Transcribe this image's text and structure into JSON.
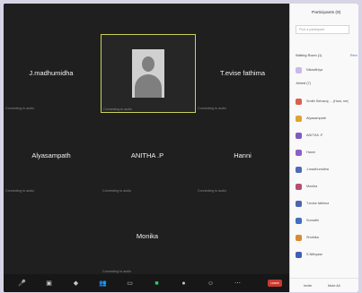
{
  "meeting": {
    "participants": [
      {
        "name": "J.madhumidha",
        "subtext": "Connecting to audio"
      },
      {
        "name": "",
        "subtext": "Connecting to audio"
      },
      {
        "name": "T.evise fathima",
        "subtext": "Connecting to audio"
      },
      {
        "name": "Alyasampath",
        "subtext": "Connecting to audio"
      },
      {
        "name": "ANITHA .P",
        "subtext": "Connecting to audio"
      },
      {
        "name": "Hanni",
        "subtext": "Connecting to audio"
      },
      {
        "name": "Monika",
        "subtext": "Connecting to audio"
      }
    ]
  },
  "toolbar": {
    "mic_icon": "microphone-icon",
    "video_icon": "video-icon",
    "security_icon": "shield-icon",
    "participants_icon": "people-icon",
    "chat_icon": "chat-icon",
    "share_icon": "share-screen-icon",
    "record_icon": "record-icon",
    "reactions_icon": "smile-icon",
    "apps_icon": "apps-icon",
    "more_icon": "more-icon",
    "leave_label": "Leave"
  },
  "panel": {
    "title": "Participants (9)",
    "search_placeholder": "Find a participant",
    "waiting_label": "Waiting Room (1)",
    "admit_all": "Rem",
    "waiting_items": [
      {
        "name": "Nikavithiya",
        "color": "#c9b9ef"
      }
    ],
    "joined_label": "Joined (7)",
    "joined_items": [
      {
        "name": "Smith Selvaraj ... (Host, me)",
        "color": "#d9604f"
      },
      {
        "name": "Alyasampath",
        "color": "#e1a22f"
      },
      {
        "name": "ANITHA .P",
        "color": "#7c5bc0"
      },
      {
        "name": "Hanni",
        "color": "#8d5ec9"
      },
      {
        "name": "J.madhumidha",
        "color": "#5169b9"
      },
      {
        "name": "Monika",
        "color": "#b44f72"
      },
      {
        "name": "T.evise fathima",
        "color": "#4f65b1"
      },
      {
        "name": "Sumathi",
        "color": "#3f6fbe"
      },
      {
        "name": "Shobika",
        "color": "#d98a34"
      },
      {
        "name": "S.Nithyasri",
        "color": "#3d5fb8"
      }
    ],
    "invite_label": "Invite",
    "mute_all_label": "Mute All"
  }
}
